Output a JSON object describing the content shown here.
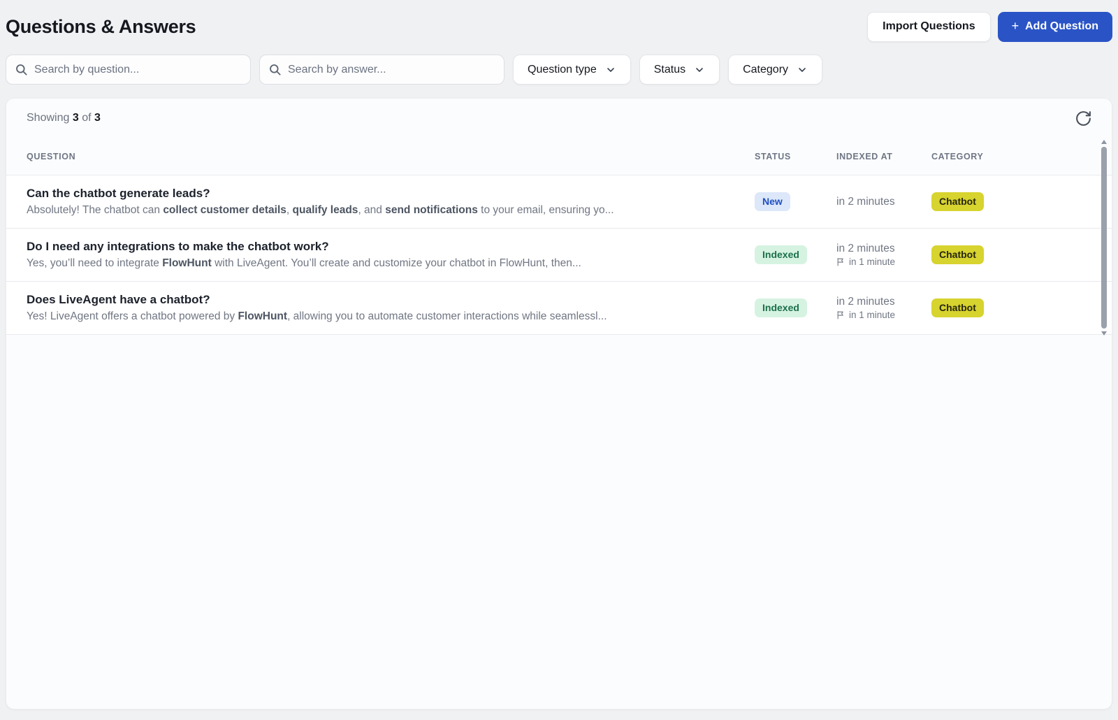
{
  "header": {
    "title": "Questions & Answers",
    "import_button": "Import Questions",
    "add_button_icon": "+",
    "add_button": "Add Question"
  },
  "filters": {
    "search_question_placeholder": "Search by question...",
    "search_answer_placeholder": "Search by answer...",
    "question_type_label": "Question type",
    "status_label": "Status",
    "category_label": "Category"
  },
  "table": {
    "showing": {
      "prefix": "Showing",
      "count": "3",
      "of_label": "of",
      "total": "3"
    },
    "columns": [
      "Question",
      "Status",
      "Indexed at",
      "Category"
    ],
    "rows": [
      {
        "question": "Can the chatbot generate leads?",
        "answer_segments": [
          {
            "text": "Absolutely! The chatbot can ",
            "bold": false
          },
          {
            "text": "collect customer details",
            "bold": true
          },
          {
            "text": ", ",
            "bold": false
          },
          {
            "text": "qualify leads",
            "bold": true
          },
          {
            "text": ", and ",
            "bold": false
          },
          {
            "text": "send notifications",
            "bold": true
          },
          {
            "text": " to your email, ensuring yo...",
            "bold": false
          }
        ],
        "status": "New",
        "status_type": "new",
        "indexed_at": "in 2 minutes",
        "indexed_secondary": "",
        "category": "Chatbot"
      },
      {
        "question": "Do I need any integrations to make the chatbot work?",
        "answer_segments": [
          {
            "text": "Yes, you’ll need to integrate ",
            "bold": false
          },
          {
            "text": "FlowHunt",
            "bold": true
          },
          {
            "text": " with LiveAgent. You’ll create and customize your chatbot in FlowHunt, then...",
            "bold": false
          }
        ],
        "status": "Indexed",
        "status_type": "indexed",
        "indexed_at": "in 2 minutes",
        "indexed_secondary": "in 1 minute",
        "category": "Chatbot"
      },
      {
        "question": "Does LiveAgent have a chatbot?",
        "answer_segments": [
          {
            "text": "Yes! LiveAgent offers a chatbot powered by ",
            "bold": false
          },
          {
            "text": "FlowHunt",
            "bold": true
          },
          {
            "text": ", allowing you to automate customer interactions while seamlessl...",
            "bold": false
          }
        ],
        "status": "Indexed",
        "status_type": "indexed",
        "indexed_at": "in 2 minutes",
        "indexed_secondary": "in 1 minute",
        "category": "Chatbot"
      }
    ]
  },
  "icons": {
    "search": "magnifier-glyph",
    "chevron_down": "chevron-down-glyph",
    "plus": "+",
    "refresh": "circular-arrow-clockwise",
    "flag": "outline-flag",
    "scroll_up": "triangle-up",
    "scroll_down": "triangle-down"
  },
  "colors": {
    "page_background": "#f0f1f3",
    "card_background": "#fbfcfd",
    "accent_blue": "#2a54c6",
    "badge_new_bg": "#dce7fa",
    "badge_new_text": "#1f4fc0",
    "badge_indexed_bg": "#d6f3e1",
    "badge_indexed_text": "#1b6f4c",
    "badge_category_bg": "#d7d32f",
    "badge_category_text": "#26260f"
  }
}
